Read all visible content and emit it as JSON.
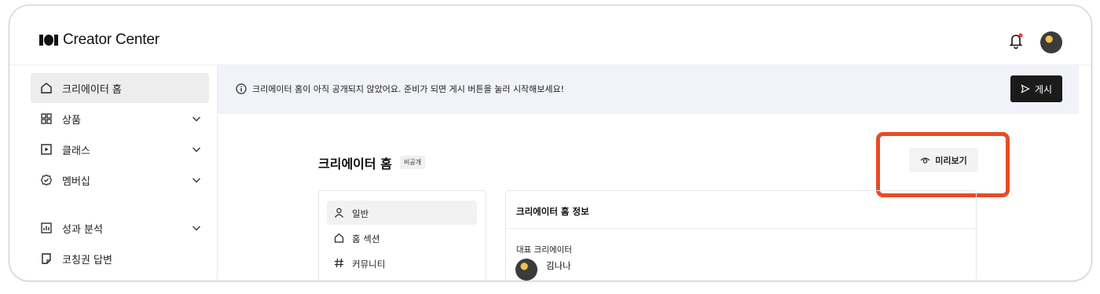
{
  "header": {
    "brand": "Creator Center",
    "icons": [
      "notification-bell-icon",
      "profile-avatar"
    ]
  },
  "sidebar": {
    "items": [
      {
        "label": "크리에이터 홈",
        "icon": "home-icon",
        "active": true
      },
      {
        "label": "상품",
        "icon": "grid-icon",
        "expandable": true
      },
      {
        "label": "클래스",
        "icon": "play-square-icon",
        "expandable": true
      },
      {
        "label": "멤버십",
        "icon": "badge-check-icon",
        "expandable": true
      },
      {
        "label": "성과 분석",
        "icon": "chart-icon",
        "expandable": true
      },
      {
        "label": "코칭권 답변",
        "icon": "note-icon"
      }
    ]
  },
  "banner": {
    "message": "크리에이터 홈이 아직 공개되지 않았어요. 준비가 되면 게시 버튼을 눌러 시작해보세요!",
    "button_label": "게시"
  },
  "page": {
    "title": "크리에이터 홈",
    "status": "비공개",
    "preview_label": "미리보기"
  },
  "subnav": {
    "items": [
      {
        "label": "일반",
        "icon": "user-icon",
        "active": true
      },
      {
        "label": "홈 섹션",
        "icon": "home-icon"
      },
      {
        "label": "커뮤니티",
        "icon": "hash-icon"
      }
    ]
  },
  "panel": {
    "title": "크리에이터 홈 정보",
    "field_label": "대표 크리에이터",
    "creator_name": "김나나"
  },
  "colors": {
    "accent_highlight": "#e84a27",
    "banner_bg": "#f1f2fa",
    "primary_button": "#1b1b1b"
  }
}
